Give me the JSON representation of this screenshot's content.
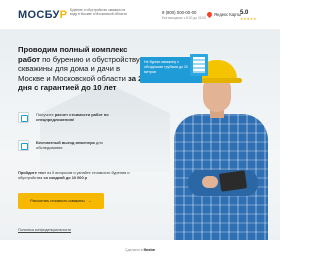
{
  "header": {
    "logo_main": "МОСБУ",
    "logo_accent": "Р",
    "tagline": "Бурение и обустройство скважин на воду в Москве и Московской области",
    "phone": "8 (800) 000-00-00",
    "schedule": "Без выходных с 8:00 до 22:00",
    "yandex_label": "Яндекс Карты",
    "rating": "5.0",
    "stars": "★★★★★"
  },
  "hero": {
    "headline_bold": "Проводим полный комплекс работ",
    "headline_plain_1": " по бурению и обустройству скважины для дома и дачи в Москве и Московской области ",
    "headline_bold_2": "за 2 дня с гарантией до 10 лет",
    "promo_badge": "Не бурим скважину с обсадными трубами до 20 метров"
  },
  "features": [
    {
      "text_plain": "Получите ",
      "text_bold": "расчет стоимости работ по спецпредложению!",
      "icon": "document-icon"
    },
    {
      "text_bold": "Бесплатный выезд инженера",
      "text_plain": " для обследования",
      "icon": "engineer-icon"
    }
  ],
  "quiz": {
    "bold": "Пройдите тест",
    "plain": " из 5 вопросов и узнайте стоимость бурения и обустройства ",
    "bold_2": "со скидкой до 10 000 р"
  },
  "cta": {
    "label": "Рассчитать стоимость скважины",
    "arrow": "→"
  },
  "privacy_link": "Политика конфиденциальности",
  "footer": {
    "prefix": "Сделано в ",
    "brand": "flexbe"
  },
  "colors": {
    "accent_yellow": "#f6b800",
    "brand_navy": "#1e3a5f",
    "promo_blue": "#1f9bd8",
    "shirt_blue": "#2f6fb3"
  }
}
